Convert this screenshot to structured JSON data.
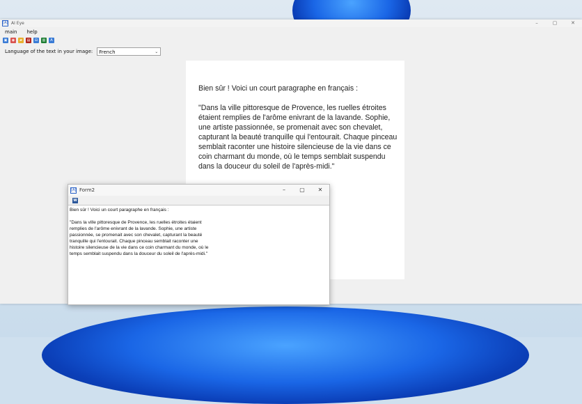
{
  "colors": {
    "accent": "#1a66e6",
    "word_blue": "#2b579a"
  },
  "main_window": {
    "title": "AI Eye",
    "app_icon": "[A]",
    "controls": {
      "minimize": "–",
      "maximize": "▢",
      "close": "✕"
    },
    "menu": [
      "main",
      "help"
    ],
    "toolbar": [
      {
        "icon": "image-icon",
        "glyph": "▣",
        "color": "#3a7bd5"
      },
      {
        "icon": "camera-icon",
        "glyph": "◉",
        "color": "#d9534f"
      },
      {
        "icon": "folder-icon",
        "glyph": "▰",
        "color": "#e8b030"
      },
      {
        "icon": "pdf-icon",
        "glyph": "▤",
        "color": "#b3261e"
      },
      {
        "icon": "scan-icon",
        "glyph": "⊟",
        "color": "#3a7bd5"
      },
      {
        "icon": "excel-icon",
        "glyph": "▥",
        "color": "#1e7e34"
      },
      {
        "icon": "text-icon",
        "glyph": "A",
        "color": "#3a7bd5"
      }
    ],
    "language_label": "Language of the text in your image:",
    "language_value": "French"
  },
  "document_text": "Bien sûr ! Voici un court paragraphe en français :\n\n\"Dans la ville pittoresque de Provence, les ruelles étroites étaient remplies de l'arôme enivrant de la lavande. Sophie, une artiste passionnée, se promenait avec son chevalet, capturant la beauté tranquille qui l'entourait. Chaque pinceau semblait raconter une histoire silencieuse de la vie dans ce coin charmant du monde, où le temps semblait suspendu dans la douceur du soleil de l'après-midi.\"",
  "form2": {
    "title": "Form2",
    "app_icon": "[A]",
    "controls": {
      "minimize": "–",
      "maximize": "▢",
      "close": "✕"
    },
    "toolbar_icon": "W",
    "text": "Bien sûr ! Voici un court paragraphe en français :\n\n\"Dans la ville pittoresque de Provence, les ruelles étroites étaient remplies de l'arôme enivrant de la lavande. Sophie, une artiste passionnée, se promenait avec son chevalet, capturant la beauté tranquille qui l'entourait. Chaque pinceau semblait raconter une histoire silencieuse de la vie dans ce coin charmant du monde, où le temps semblait suspendu dans la douceur du soleil de l'après-midi.\""
  }
}
